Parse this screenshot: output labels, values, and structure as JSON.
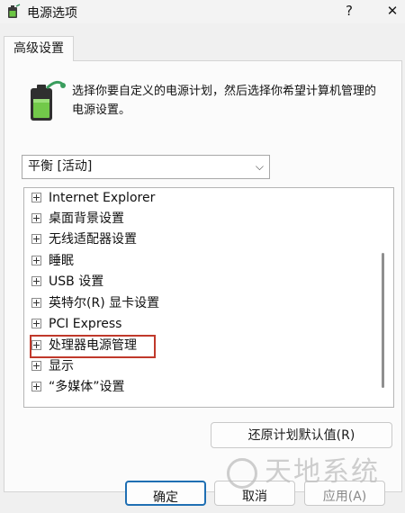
{
  "window": {
    "title": "电源选项",
    "help_glyph": "?",
    "close_glyph": "✕"
  },
  "tab": {
    "label": "高级设置"
  },
  "description": "选择你要自定义的电源计划，然后选择你希望计算机管理的电源设置。",
  "plan_select": {
    "value": "平衡 [活动]",
    "chevron": "⌵"
  },
  "tree": {
    "items": [
      {
        "label": "Internet Explorer"
      },
      {
        "label": "桌面背景设置"
      },
      {
        "label": "无线适配器设置"
      },
      {
        "label": "睡眠"
      },
      {
        "label": "USB 设置"
      },
      {
        "label": "英特尔(R) 显卡设置"
      },
      {
        "label": "PCI Express"
      },
      {
        "label": "处理器电源管理"
      },
      {
        "label": "显示"
      },
      {
        "label": "“多媒体”设置"
      }
    ],
    "highlight_color": "#c0392b"
  },
  "buttons": {
    "restore": "还原计划默认值(R)",
    "ok": "确定",
    "cancel": "取消",
    "apply": "应用(A)"
  },
  "watermark": "天地系统"
}
